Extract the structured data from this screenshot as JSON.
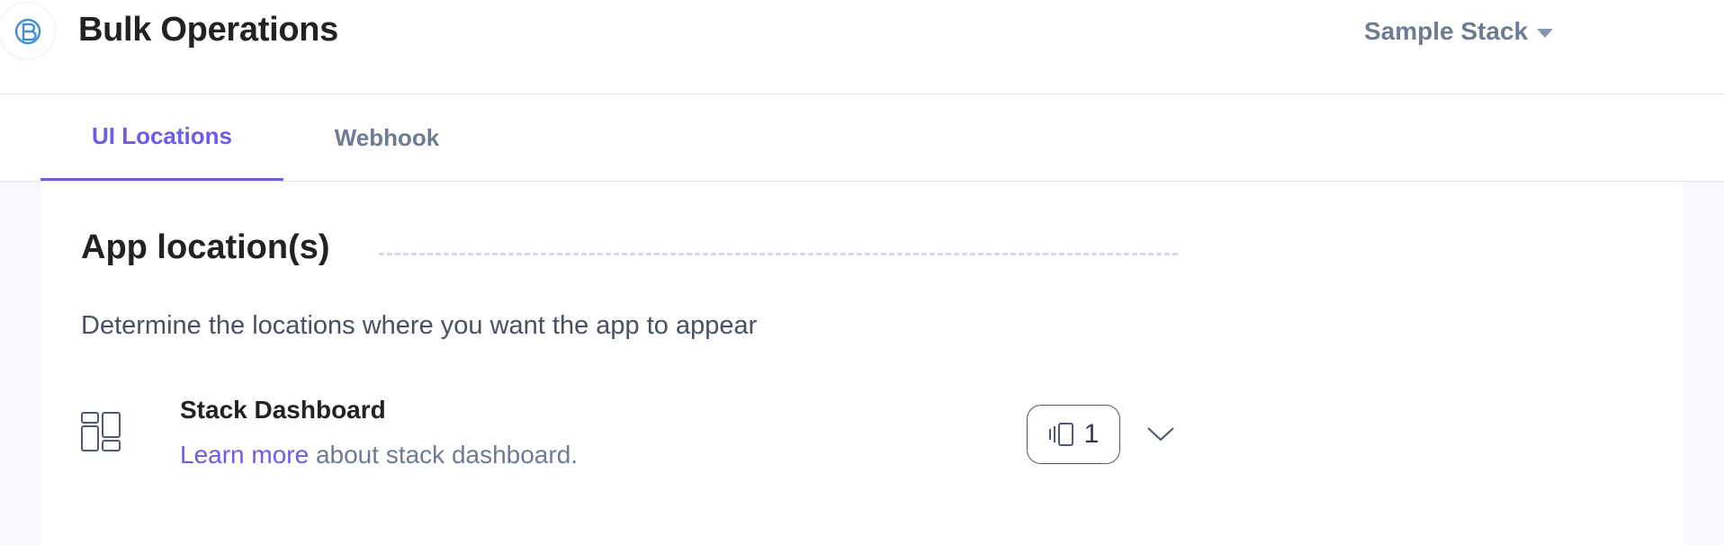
{
  "header": {
    "app_title": "Bulk Operations",
    "logo_icon": "app-logo-icon",
    "stack_selector": {
      "value": "Sample Stack",
      "icon": "caret-down-icon"
    }
  },
  "tabs": [
    {
      "label": "UI Locations",
      "active": true
    },
    {
      "label": "Webhook",
      "active": false
    }
  ],
  "content": {
    "section_title": "App location(s)",
    "description": "Determine the locations where you want the app to appear",
    "locations": [
      {
        "title": "Stack Dashboard",
        "link_text": "Learn more",
        "description_suffix": " about stack dashboard.",
        "icon": "dashboard-icon",
        "count": "1",
        "count_icon": "widget-icon",
        "expand_icon": "chevron-down-icon"
      }
    ]
  },
  "colors": {
    "accent": "#6c5ce7",
    "muted_text": "#6e7b92",
    "page_bg": "#f7f8fb",
    "dashed_rule": "#ddd3f3"
  }
}
